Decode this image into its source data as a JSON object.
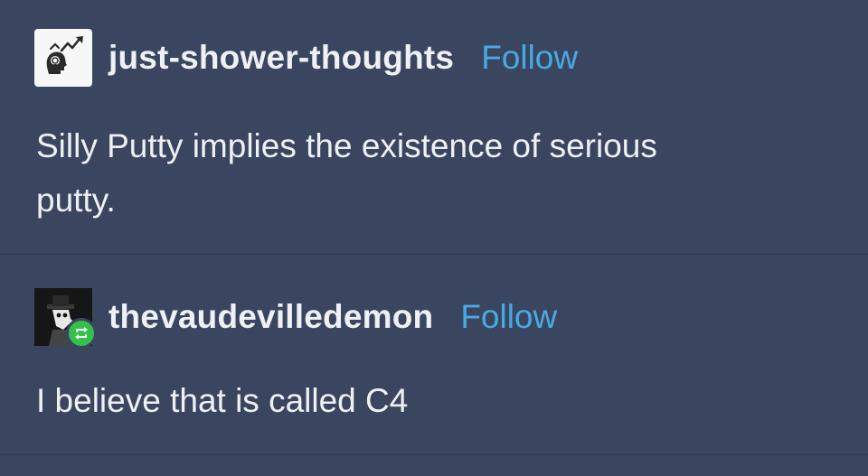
{
  "posts": [
    {
      "username": "just-shower-thoughts",
      "follow_label": "Follow",
      "body_line_1": "Silly Putty implies the existence of serious",
      "body_line_2": "putty."
    },
    {
      "username": "thevaudevilledemon",
      "follow_label": "Follow",
      "body_line_1": "I believe that is called C4"
    }
  ],
  "icons": {
    "avatar_1": "lightbulb-head-trend-icon",
    "avatar_2": "plague-doctor-icon",
    "reblog": "reblog-icon"
  },
  "colors": {
    "background": "#3a4660",
    "text": "#eef0f4",
    "follow": "#4aa9e0",
    "reblog_badge": "#33c14b"
  }
}
